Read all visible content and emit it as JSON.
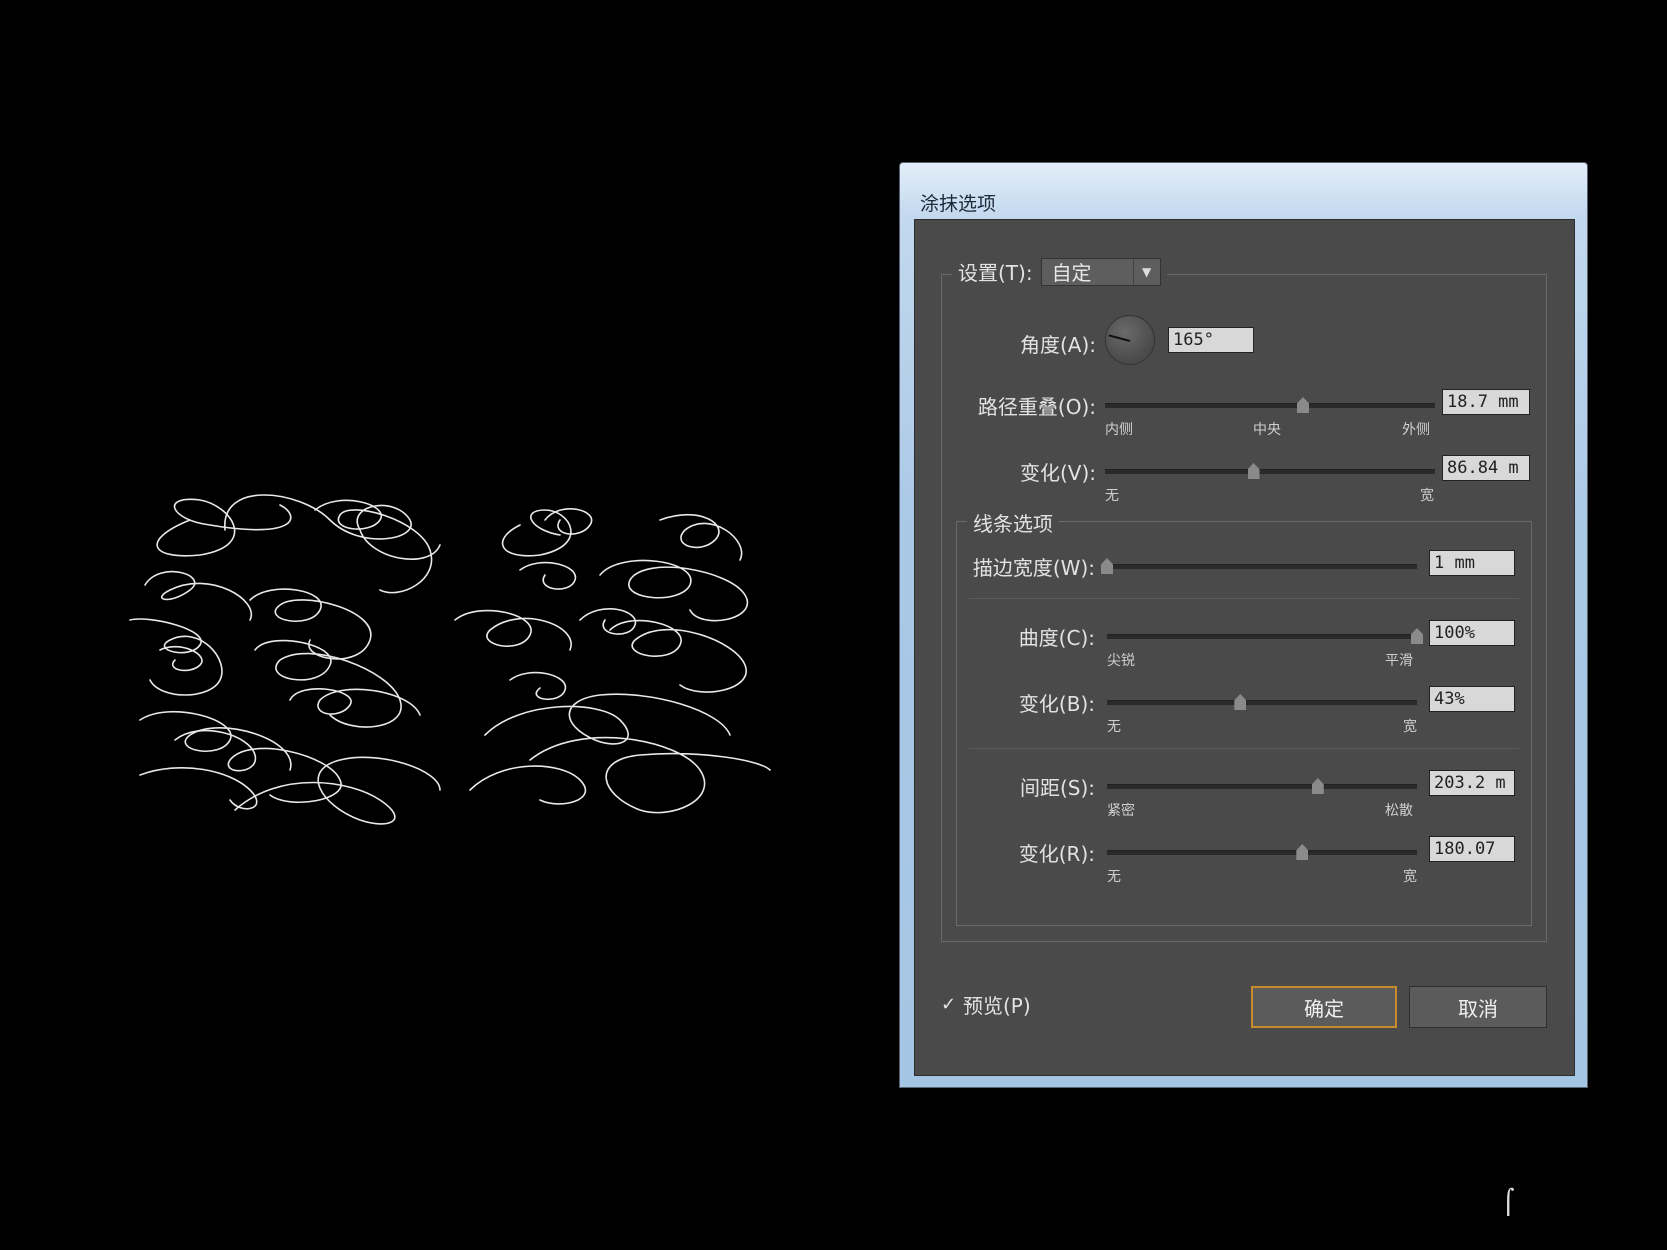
{
  "window": {
    "title": "涂抹选项"
  },
  "settings": {
    "label": "设置(T):",
    "value": "自定"
  },
  "angle": {
    "label": "角度(A):",
    "value": "165°",
    "degrees": 165
  },
  "path_overlap": {
    "label": "路径重叠(O):",
    "value": "18.7 mm",
    "fraction": 0.6,
    "ticks": [
      "内侧",
      "中央",
      "外侧"
    ]
  },
  "variation_v": {
    "label": "变化(V):",
    "value": "86.84 m",
    "fraction": 0.45,
    "ticks": [
      "无",
      "宽"
    ]
  },
  "line_options": {
    "title": "线条选项",
    "stroke_width": {
      "label": "描边宽度(W):",
      "value": "1 mm",
      "fraction": 0.0
    },
    "curviness": {
      "label": "曲度(C):",
      "value": "100%",
      "fraction": 1.0,
      "ticks": [
        "尖锐",
        "平滑"
      ]
    },
    "variation_b": {
      "label": "变化(B):",
      "value": "43%",
      "fraction": 0.43,
      "ticks": [
        "无",
        "宽"
      ]
    },
    "spacing": {
      "label": "间距(S):",
      "value": "203.2 m",
      "fraction": 0.68,
      "ticks": [
        "紧密",
        "松散"
      ]
    },
    "variation_r": {
      "label": "变化(R):",
      "value": "180.07",
      "fraction": 0.63,
      "ticks": [
        "无",
        "宽"
      ]
    }
  },
  "preview": {
    "label": "预览(P)",
    "checked": true,
    "check_glyph": "✓"
  },
  "buttons": {
    "ok": "确定",
    "cancel": "取消"
  },
  "dropdown_glyph": "▼",
  "cursor_glyph": "⌠"
}
